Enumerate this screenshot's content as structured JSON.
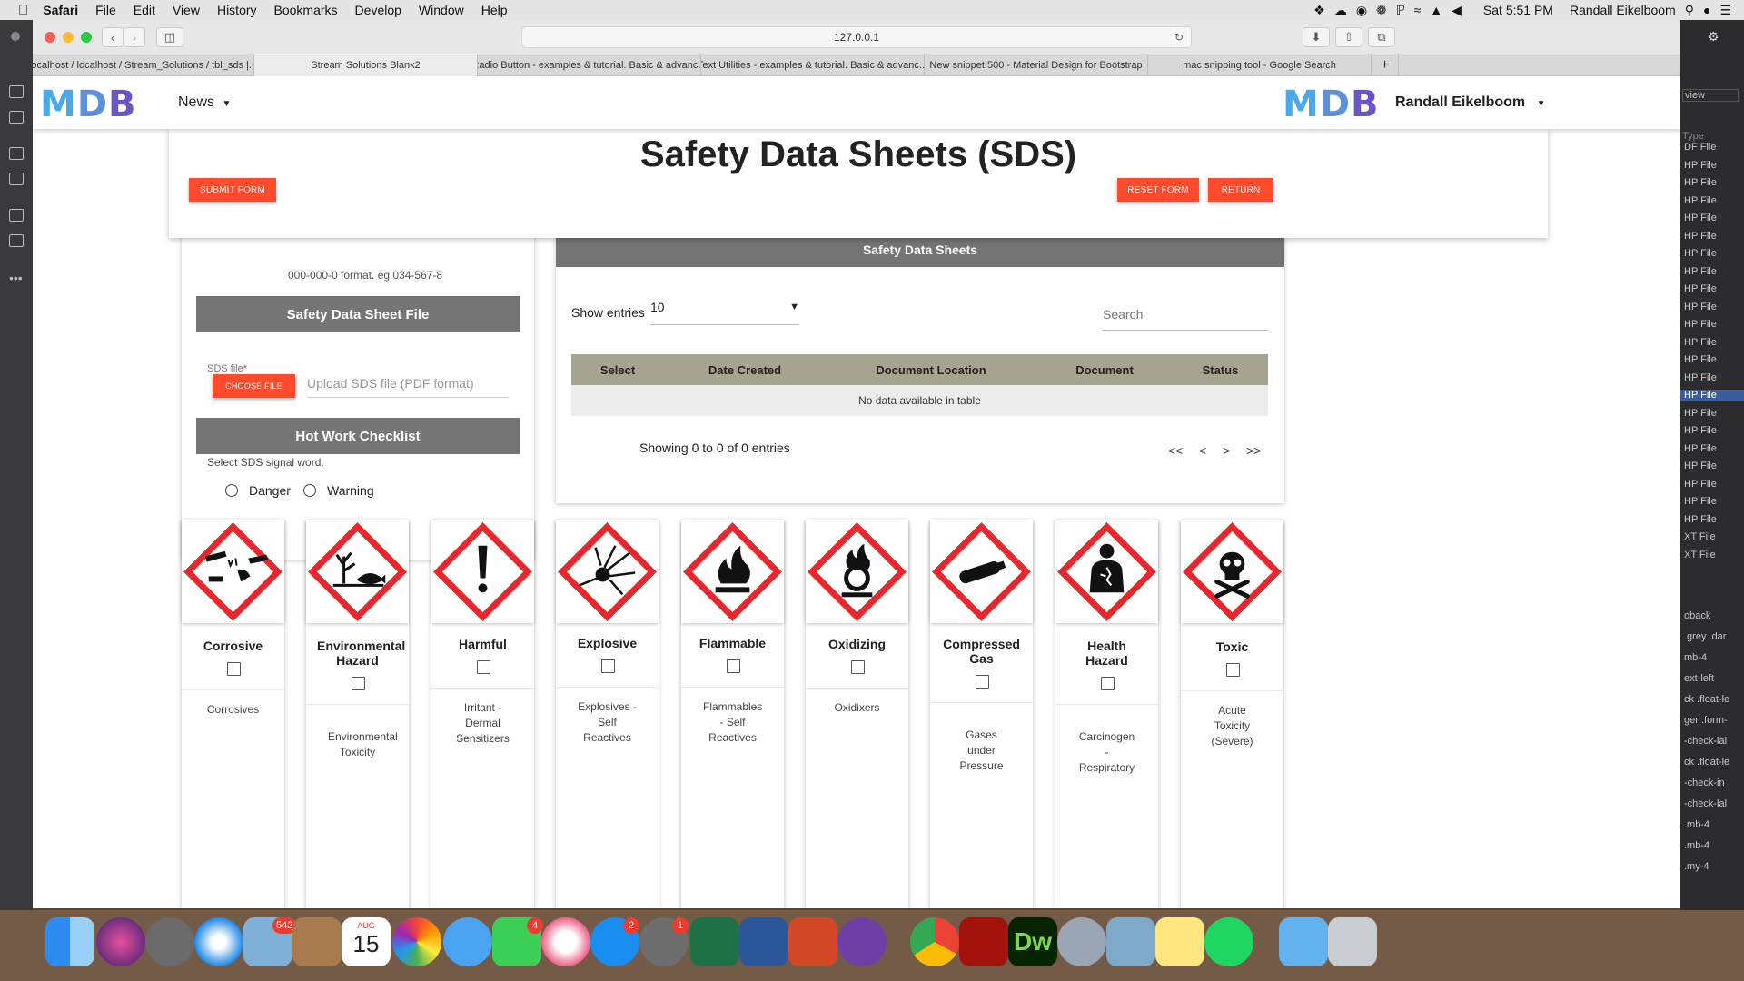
{
  "menubar": {
    "items": [
      "Safari",
      "File",
      "Edit",
      "View",
      "History",
      "Bookmarks",
      "Develop",
      "Window",
      "Help"
    ],
    "clock": "Sat 5:51 PM",
    "user": "Randall Eikelboom"
  },
  "browser": {
    "url": "127.0.0.1",
    "tabs": [
      "localhost / localhost / Stream_Solutions / tbl_sds |...",
      "Stream Solutions Blank2",
      "Radio Button - examples & tutorial. Basic & advanc...",
      "Text Utilities - examples & tutorial. Basic & advanc...",
      "New snippet 500 - Material Design for Bootstrap",
      "mac snipping tool - Google Search"
    ],
    "active_tab": 1
  },
  "navbar": {
    "logo": [
      "M",
      "D",
      "B"
    ],
    "news_label": "News",
    "user_label": "Randall Eikelboom"
  },
  "header": {
    "title": "Safety Data Sheets (SDS)",
    "submit_label": "SUBMIT FORM",
    "reset_label": "RESET FORM",
    "return_label": "RETURN"
  },
  "form": {
    "cut_text": "000-000-0 format. eg 034-567-8",
    "sds_section": "Safety Data Sheet File",
    "sds_field_label": "SDS file",
    "required_mark": "*",
    "choose_label": "CHOOSE FILE",
    "upload_placeholder": "Upload SDS file (PDF format)",
    "hotwork_section": "Hot Work Checklist",
    "signal_prompt": "Select SDS signal word.",
    "signal_options": [
      "Danger",
      "Warning"
    ]
  },
  "table": {
    "title": "Safety Data Sheets",
    "show_label": "Show entries",
    "entries_value": "10",
    "search_placeholder": "Search",
    "columns": [
      "Select",
      "Date Created",
      "Document Location",
      "Document",
      "Status"
    ],
    "empty_text": "No data available in table",
    "summary": "Showing 0 to 0 of 0 entries",
    "pager": [
      "<<",
      "<",
      ">",
      ">>"
    ]
  },
  "hazards": [
    {
      "name": "Corrosive",
      "desc": "Corrosives",
      "icon": "corrosion-pictogram-icon"
    },
    {
      "name": "Environmental Hazard",
      "desc": "Environmental Toxicity",
      "icon": "environment-pictogram-icon"
    },
    {
      "name": "Harmful",
      "desc": "Irritant - Dermal Sensitizers",
      "icon": "exclamation-pictogram-icon"
    },
    {
      "name": "Explosive",
      "desc": "Explosives - Self Reactives",
      "icon": "exploding-bomb-pictogram-icon"
    },
    {
      "name": "Flammable",
      "desc": "Flammables - Self Reactives",
      "icon": "flame-pictogram-icon"
    },
    {
      "name": "Oxidizing",
      "desc": "Oxidixers",
      "icon": "flame-over-circle-pictogram-icon"
    },
    {
      "name": "Compressed Gas",
      "desc": "Gases under Pressure",
      "icon": "gas-cylinder-pictogram-icon"
    },
    {
      "name": "Health Hazard",
      "desc": "Carcinogen - Respiratory",
      "icon": "health-hazard-pictogram-icon"
    },
    {
      "name": "Toxic",
      "desc": "Acute Toxicity (Severe)",
      "icon": "skull-crossbones-pictogram-icon"
    }
  ],
  "right_panel": {
    "header": "view",
    "type_header": "Type",
    "file_items": [
      "DF File",
      "HP File",
      "HP File",
      "HP File",
      "HP File",
      "HP File",
      "HP File",
      "HP File",
      "HP File",
      "HP File",
      "HP File",
      "HP File",
      "HP File",
      "HP File",
      "HP File",
      "HP File",
      "HP File",
      "HP File",
      "HP File",
      "HP File",
      "HP File",
      "HP File",
      "XT File",
      "XT File"
    ],
    "class_items": [
      "oback",
      ".grey .dar",
      "mb-4",
      "ext-left",
      "ck .float-le",
      "ger .form-",
      "-check-lal",
      "ck .float-le",
      "-check-in",
      "-check-lal",
      ".mb-4",
      ".mb-4",
      ".my-4"
    ]
  },
  "dock": {
    "badges": {
      "mail": "542",
      "calendar_month": "AUG",
      "calendar_day": "15",
      "facetime": "4",
      "appstore": "2",
      "sysprefs": "1"
    },
    "dw_label": "Dw"
  },
  "colors": {
    "accent": "#ff4a2b",
    "gray_header": "#757575",
    "table_header": "#a6a390",
    "hazard_red": "#e8272c"
  }
}
